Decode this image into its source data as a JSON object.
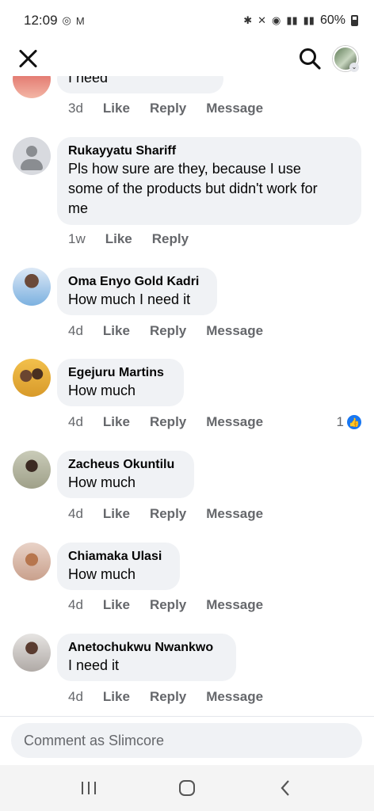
{
  "status_bar": {
    "time": "12:09",
    "battery": "60%"
  },
  "header": {
    "close_icon": "close-icon",
    "search_icon": "search-icon"
  },
  "partial_comment": {
    "text": "I need",
    "time": "3d",
    "like": "Like",
    "reply": "Reply",
    "message": "Message"
  },
  "comments": [
    {
      "name": "Rukayyatu Shariff",
      "text_lines": [
        "Pls how sure are they, because I use",
        "some of the products but didn't work for",
        "me"
      ],
      "time": "1w",
      "like": "Like",
      "reply": "Reply"
    },
    {
      "name": "Oma Enyo Gold Kadri",
      "text": "How much I need it",
      "time": "4d",
      "like": "Like",
      "reply": "Reply",
      "message": "Message"
    },
    {
      "name": "Egejuru Martins",
      "text": "How much",
      "time": "4d",
      "like": "Like",
      "reply": "Reply",
      "message": "Message",
      "reaction_count": "1"
    },
    {
      "name": "Zacheus Okuntilu",
      "text": "How much",
      "time": "4d",
      "like": "Like",
      "reply": "Reply",
      "message": "Message"
    },
    {
      "name": "Chiamaka Ulasi",
      "text": "How much",
      "time": "4d",
      "like": "Like",
      "reply": "Reply",
      "message": "Message"
    },
    {
      "name": "Anetochukwu Nwankwo",
      "text": "I need it",
      "time": "4d",
      "like": "Like",
      "reply": "Reply",
      "message": "Message"
    }
  ],
  "composer": {
    "placeholder": "Comment as Slimcore"
  },
  "navbar": {
    "recents_icon": "recents-icon",
    "home_icon": "home-icon",
    "back_icon": "back-icon"
  },
  "colors": {
    "accent": "#1877f2",
    "bubble": "#f0f2f5",
    "meta": "#65676b"
  }
}
